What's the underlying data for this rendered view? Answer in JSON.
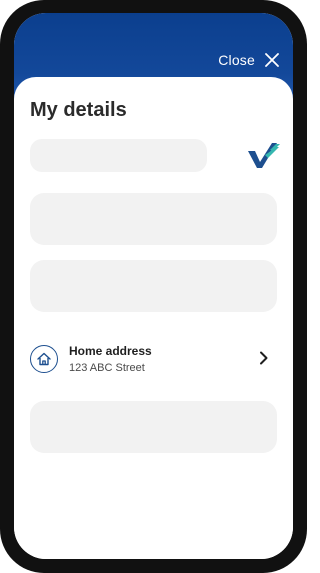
{
  "header": {
    "close_label": "Close",
    "close_icon": "close-icon",
    "gradient": [
      "#0b3f8e",
      "#2a63b8"
    ]
  },
  "page": {
    "title": "My details"
  },
  "logo": {
    "icon": "checkmark-logo",
    "colors": [
      "#1d4f8f",
      "#35b7b0"
    ]
  },
  "address": {
    "icon": "home-icon",
    "title": "Home address",
    "value": "123 ABC Street",
    "chevron": "chevron-right-icon"
  }
}
